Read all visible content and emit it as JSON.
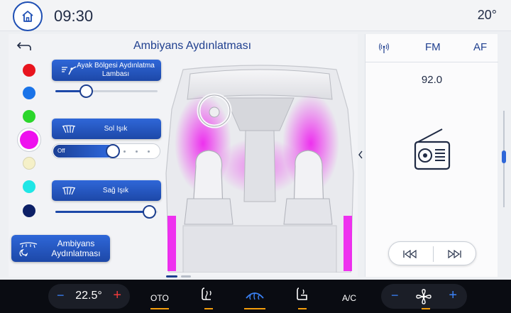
{
  "status_bar": {
    "clock": "09:30",
    "outside_temp": "20°",
    "home_icon": "home-icon"
  },
  "ambient": {
    "title": "Ambiyans Aydınlatması",
    "back_icon": "back-arrow-icon",
    "colors": [
      {
        "name": "red",
        "hex": "#e8141e",
        "selected": false
      },
      {
        "name": "blue",
        "hex": "#1a73e8",
        "selected": false
      },
      {
        "name": "green",
        "hex": "#2bd62b",
        "selected": false
      },
      {
        "name": "magenta",
        "hex": "#ee10ee",
        "selected": true
      },
      {
        "name": "cream",
        "hex": "#f5f0c8",
        "selected": false
      },
      {
        "name": "cyan",
        "hex": "#1fe6e6",
        "selected": false
      },
      {
        "name": "navy",
        "hex": "#0c1f66",
        "selected": false
      }
    ],
    "zones": [
      {
        "label": "Ayak Bölgesi Aydınlatma Lambası",
        "icon": "footwell-light-icon",
        "level": 0.3
      },
      {
        "label": "Sol Işık",
        "icon": "left-light-icon",
        "off_label": "Off",
        "level": 0.55
      },
      {
        "label": "Sağ Işık",
        "icon": "right-light-icon",
        "level": 0.92
      }
    ],
    "ambient_button_label": "Ambiyans Aydınlatması",
    "ambient_button_icon": "ambient-lighting-icon",
    "accent_color": "#ee10ee"
  },
  "radio": {
    "signal_icon": "radio-signal-icon",
    "band": "FM",
    "af": "AF",
    "frequency": "92.0",
    "radio_icon": "radio-icon",
    "prev_icon": "previous-track-icon",
    "next_icon": "next-track-icon"
  },
  "climate": {
    "temp_minus": "−",
    "setpoint": "22.5°",
    "temp_plus": "+",
    "auto_label": "OTO",
    "ac_label": "A/C",
    "fan_minus": "−",
    "fan_plus": "+"
  },
  "colors": {
    "brand_blue": "#1d48a8",
    "indicator_orange": "#f59e0b",
    "climate_bar": "#0a0c12"
  }
}
